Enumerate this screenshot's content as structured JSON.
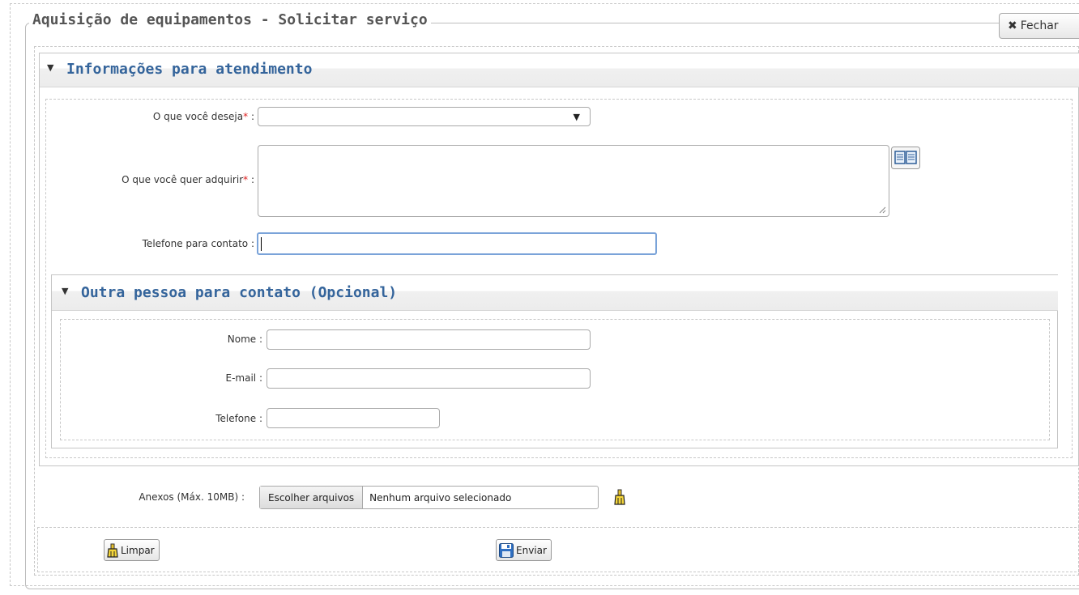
{
  "window": {
    "title": "Aquisição de equipamentos - Solicitar serviço",
    "close_label": "Fechar",
    "close_icon": "close-icon"
  },
  "section_info": {
    "title": "Informações para atendimento",
    "fields": {
      "desire_label": "O que você deseja",
      "desire_value": "",
      "acquire_label": "O que você quer adquirir",
      "acquire_value": "",
      "phone_label": "Telefone para contato",
      "phone_value": "",
      "required_mark": "*",
      "separator": ":"
    }
  },
  "section_contact": {
    "title": "Outra pessoa para contato (Opcional)",
    "name_label": "Nome",
    "email_label": "E-mail",
    "phone_label": "Telefone",
    "name_value": "",
    "email_value": "",
    "phone_value": ""
  },
  "attachments": {
    "label": "Anexos (Máx. 10MB)",
    "choose_button": "Escolher arquivos",
    "status": "Nenhum arquivo selecionado"
  },
  "actions": {
    "clear_label": "Limpar",
    "send_label": "Enviar"
  }
}
